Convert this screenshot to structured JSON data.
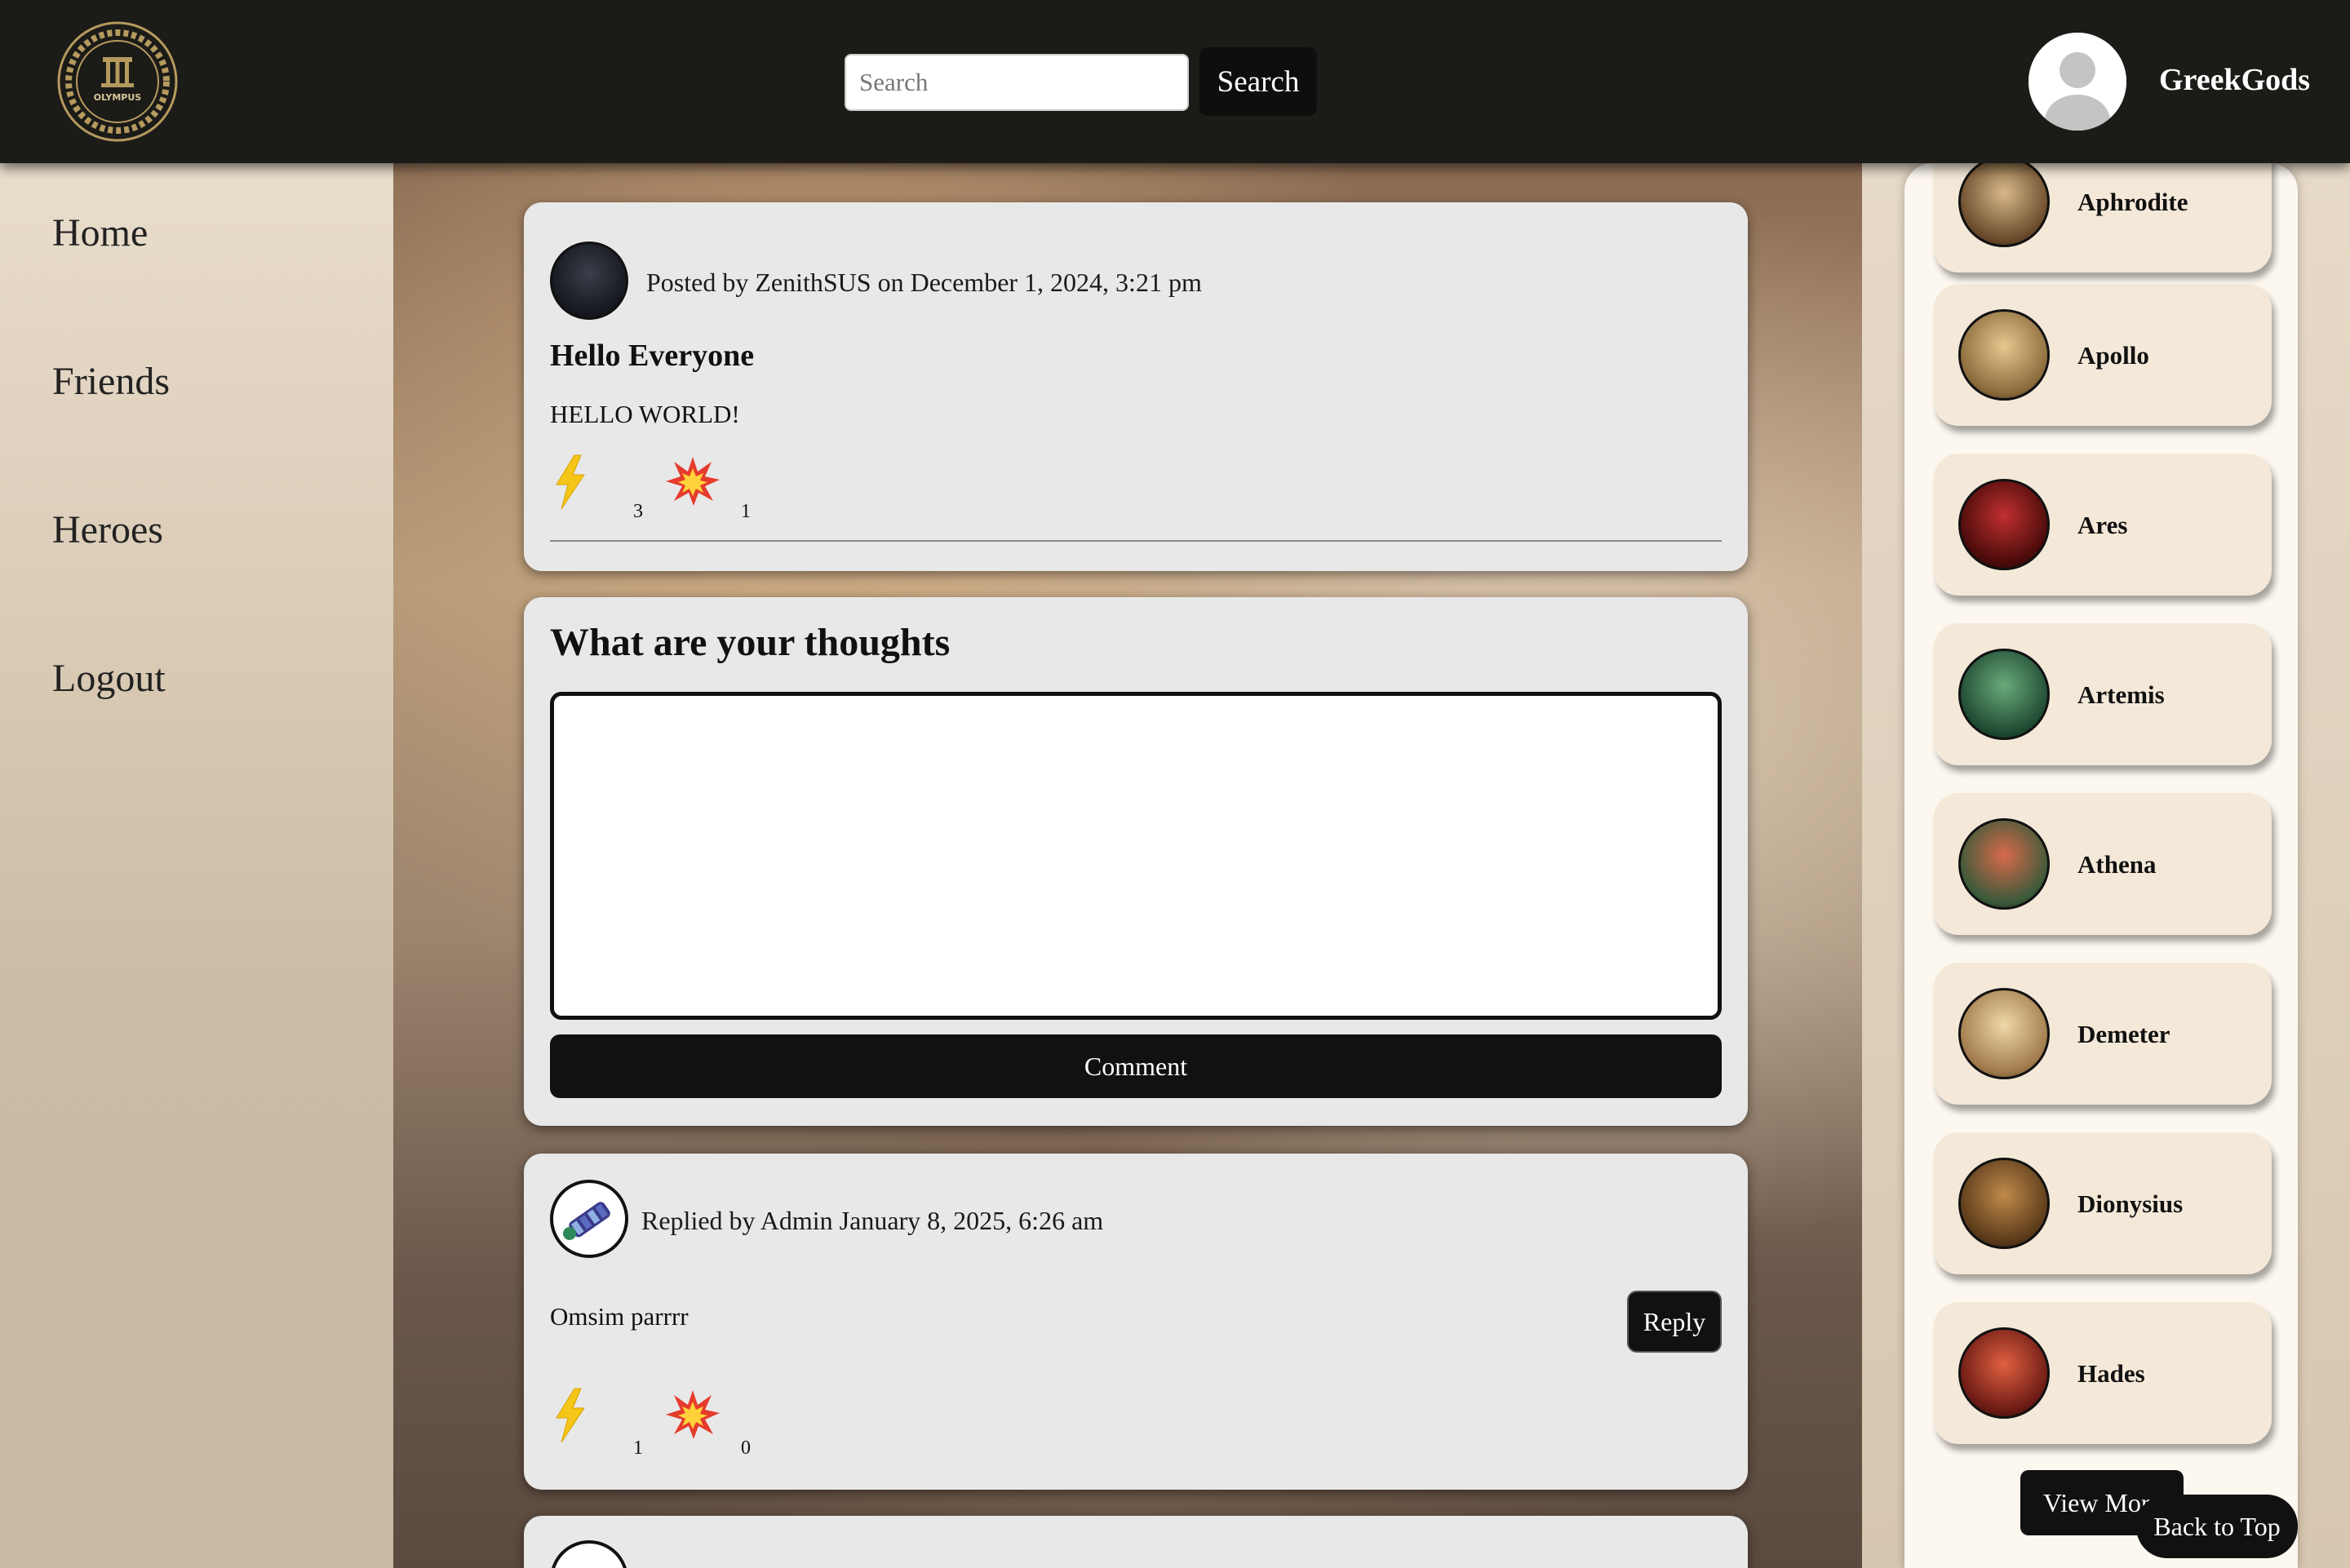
{
  "header": {
    "logo_text": "OLYMPUS",
    "search_placeholder": "Search",
    "search_label": "Search",
    "username": "GreekGods"
  },
  "nav": {
    "items": [
      {
        "label": "Home"
      },
      {
        "label": "Friends"
      },
      {
        "label": "Heroes"
      },
      {
        "label": "Logout"
      }
    ]
  },
  "post": {
    "meta": "Posted by ZenithSUS on December 1, 2024, 3:21 pm",
    "title": "Hello Everyone",
    "body": "HELLO WORLD!",
    "lightning_count": "3",
    "explosion_count": "1"
  },
  "comment_form": {
    "heading": "What are your thoughts",
    "button_label": "Comment"
  },
  "reply": {
    "meta": "Replied by Admin January 8, 2025, 6:26 am",
    "body": "Omsim parrrr",
    "reply_label": "Reply",
    "lightning_count": "1",
    "explosion_count": "0"
  },
  "sidebar": {
    "gods": [
      {
        "name": "Aphrodite",
        "color": "#b08a62"
      },
      {
        "name": "Apollo",
        "color": "#c9a060"
      },
      {
        "name": "Ares",
        "color": "#7a1a1a"
      },
      {
        "name": "Artemis",
        "color": "#2f6a4a"
      },
      {
        "name": "Athena",
        "color": "#8a3a2a"
      },
      {
        "name": "Demeter",
        "color": "#c9a070"
      },
      {
        "name": "Dionysius",
        "color": "#8a5a2a"
      },
      {
        "name": "Hades",
        "color": "#a04030"
      }
    ],
    "view_more_label": "View More"
  },
  "back_to_top_label": "Back to Top",
  "colors": {
    "header_bg": "#1b1b18",
    "card_bg": "#e8e8e8",
    "button_bg": "#111111",
    "god_card_bg": "#f4e9d9"
  }
}
